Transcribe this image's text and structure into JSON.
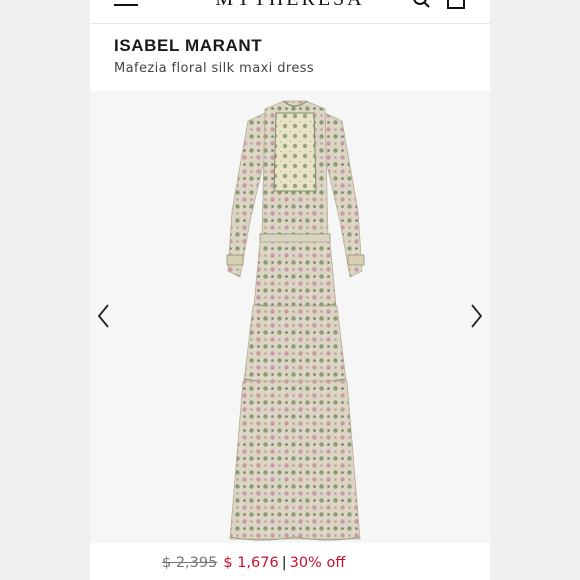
{
  "header": {
    "logo": "MYTHERESA"
  },
  "product": {
    "brand": "ISABEL MARANT",
    "name": "Mafezia floral silk maxi dress"
  },
  "pricing": {
    "original_price": "$ 2,395",
    "sale_price": "$ 1,676",
    "separator": "|",
    "discount": "30% off"
  },
  "colors": {
    "sale": "#c8102e",
    "dress_base": "#d9d1bf",
    "dress_green": "#7d8f6a",
    "dress_pink": "#c79aa5"
  }
}
